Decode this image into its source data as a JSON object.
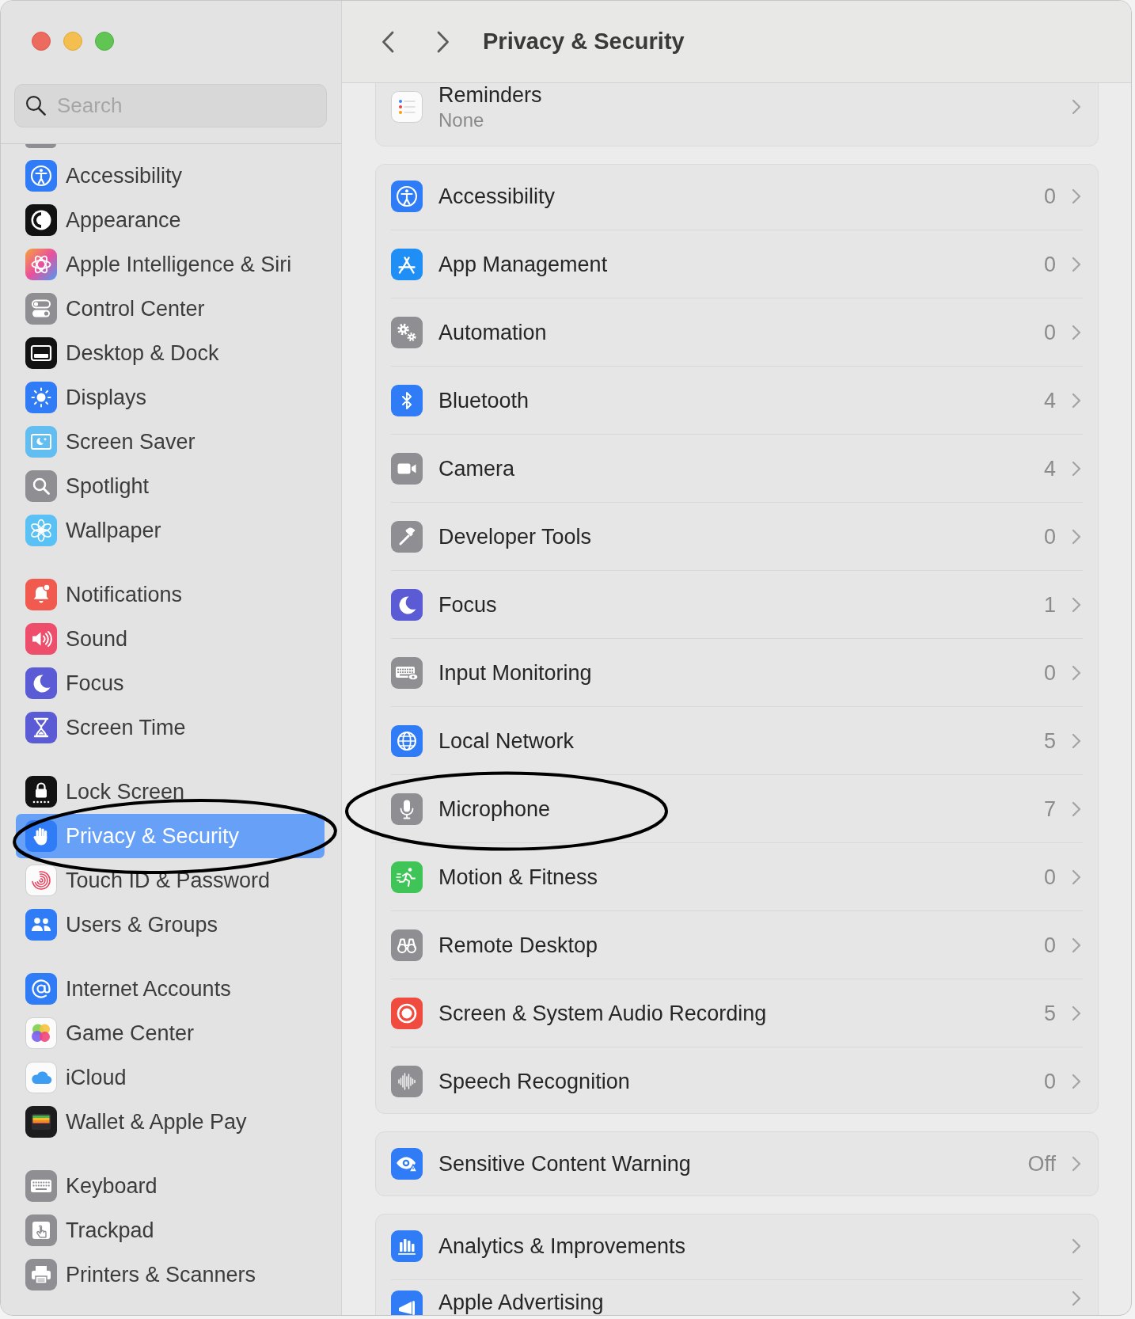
{
  "toolbar": {
    "title": "Privacy & Security"
  },
  "sidebar": {
    "search": {
      "placeholder": "Search"
    },
    "groups": [
      {
        "items": [
          {
            "label": "Accessibility",
            "selected": false,
            "circled": false
          },
          {
            "label": "Appearance",
            "selected": false,
            "circled": false
          },
          {
            "label": "Apple Intelligence & Siri",
            "selected": false,
            "circled": false
          },
          {
            "label": "Control Center",
            "selected": false,
            "circled": false
          },
          {
            "label": "Desktop & Dock",
            "selected": false,
            "circled": false
          },
          {
            "label": "Displays",
            "selected": false,
            "circled": false
          },
          {
            "label": "Screen Saver",
            "selected": false,
            "circled": false
          },
          {
            "label": "Spotlight",
            "selected": false,
            "circled": false
          },
          {
            "label": "Wallpaper",
            "selected": false,
            "circled": false
          }
        ]
      },
      {
        "items": [
          {
            "label": "Notifications",
            "selected": false,
            "circled": false
          },
          {
            "label": "Sound",
            "selected": false,
            "circled": false
          },
          {
            "label": "Focus",
            "selected": false,
            "circled": false
          },
          {
            "label": "Screen Time",
            "selected": false,
            "circled": false
          }
        ]
      },
      {
        "items": [
          {
            "label": "Lock Screen",
            "selected": false,
            "circled": false
          },
          {
            "label": "Privacy & Security",
            "selected": true,
            "circled": true
          },
          {
            "label": "Touch ID & Password",
            "selected": false,
            "circled": false
          },
          {
            "label": "Users & Groups",
            "selected": false,
            "circled": false
          }
        ]
      },
      {
        "items": [
          {
            "label": "Internet Accounts",
            "selected": false,
            "circled": false
          },
          {
            "label": "Game Center",
            "selected": false,
            "circled": false
          },
          {
            "label": "iCloud",
            "selected": false,
            "circled": false
          },
          {
            "label": "Wallet & Apple Pay",
            "selected": false,
            "circled": false
          }
        ]
      },
      {
        "items": [
          {
            "label": "Keyboard",
            "selected": false,
            "circled": false
          },
          {
            "label": "Trackpad",
            "selected": false,
            "circled": false
          },
          {
            "label": "Printers & Scanners",
            "selected": false,
            "circled": false
          }
        ]
      }
    ]
  },
  "content": {
    "cards": [
      {
        "rows": [
          {
            "label": "Reminders",
            "subtitle": "None",
            "circled": false
          }
        ]
      },
      {
        "rows": [
          {
            "label": "Accessibility",
            "value": "0",
            "circled": false
          },
          {
            "label": "App Management",
            "value": "0",
            "circled": false
          },
          {
            "label": "Automation",
            "value": "0",
            "circled": false
          },
          {
            "label": "Bluetooth",
            "value": "4",
            "circled": false
          },
          {
            "label": "Camera",
            "value": "4",
            "circled": false
          },
          {
            "label": "Developer Tools",
            "value": "0",
            "circled": false
          },
          {
            "label": "Focus",
            "value": "1",
            "circled": false
          },
          {
            "label": "Input Monitoring",
            "value": "0",
            "circled": false
          },
          {
            "label": "Local Network",
            "value": "5",
            "circled": false
          },
          {
            "label": "Microphone",
            "value": "7",
            "circled": true
          },
          {
            "label": "Motion & Fitness",
            "value": "0",
            "circled": false
          },
          {
            "label": "Remote Desktop",
            "value": "0",
            "circled": false
          },
          {
            "label": "Screen & System Audio Recording",
            "value": "5",
            "circled": false
          },
          {
            "label": "Speech Recognition",
            "value": "0",
            "circled": false
          }
        ]
      },
      {
        "rows": [
          {
            "label": "Sensitive Content Warning",
            "value": "Off",
            "circled": false
          }
        ]
      },
      {
        "rows": [
          {
            "label": "Analytics & Improvements",
            "circled": false
          },
          {
            "label": "Apple Advertising",
            "circled": false
          }
        ]
      }
    ]
  }
}
